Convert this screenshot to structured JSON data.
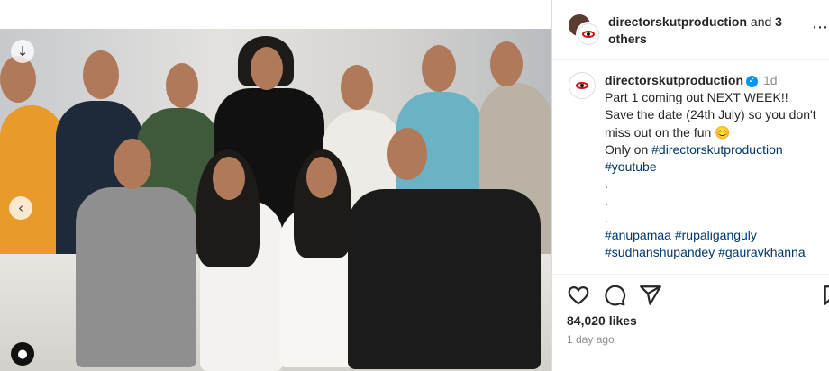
{
  "header": {
    "username": "directorskutproduction",
    "and_text": "and",
    "others": "3 others"
  },
  "caption": {
    "username": "directorskutproduction",
    "time": "1d",
    "line1": "Part 1 coming out NEXT WEEK!!",
    "line2": "Save the date (24th July) so you don't",
    "line3": "miss out on the fun",
    "emoji": "😊",
    "line4_prefix": "Only on",
    "tag1": "#directorskutproduction",
    "tag2": "#youtube",
    "dots": [
      ".",
      ".",
      "."
    ],
    "tags_row1": "#anupamaa #rupaliganguly",
    "tags_row2": "#sudhanshupandey #gauravkhanna"
  },
  "stats": {
    "likes": "84,020 likes",
    "ago": "1 day ago"
  },
  "icons": {
    "like": "heart-icon",
    "comment": "comment-icon",
    "share": "send-icon",
    "save": "bookmark-icon",
    "more": "more-options-icon",
    "download": "arrow-down-icon",
    "prev": "chevron-left-icon",
    "tag": "user-tag-icon"
  },
  "colors": {
    "link": "#00376b",
    "verified": "#0095f6",
    "muted": "#8e8e8e"
  }
}
